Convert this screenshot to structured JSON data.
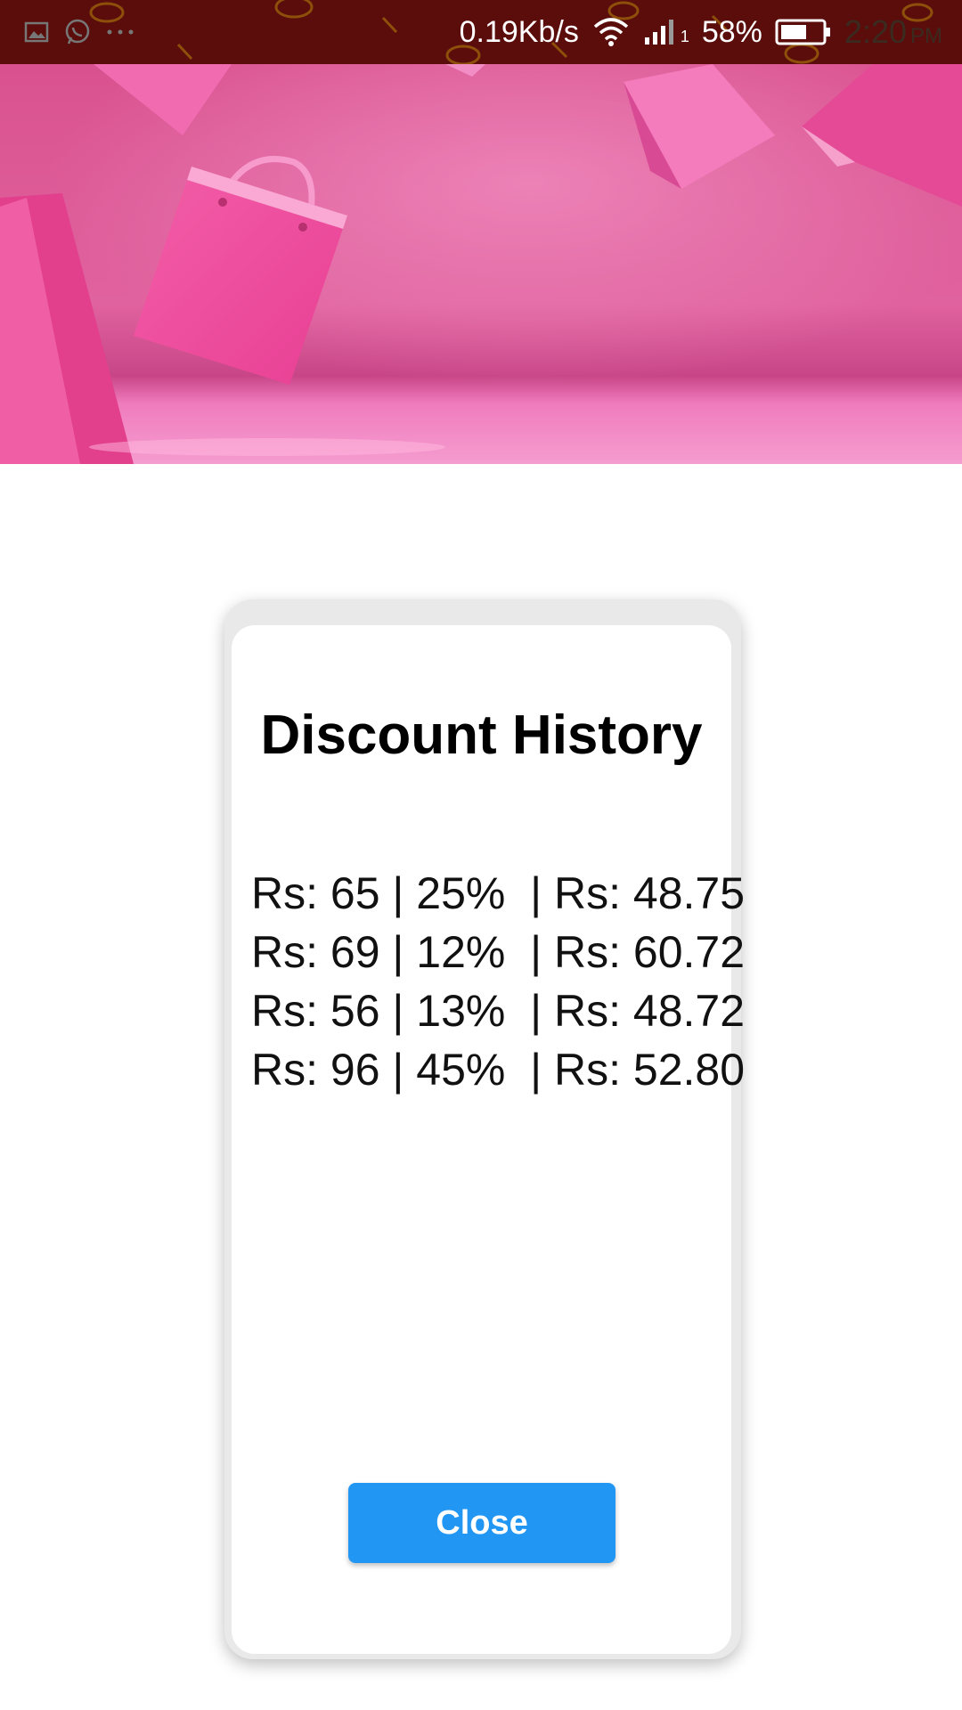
{
  "status_bar": {
    "network_speed": "0.19Kb/s",
    "sim_index": "1",
    "battery_percent": "58%",
    "time": "2:20",
    "ampm": "PM",
    "icons": [
      "gallery-icon",
      "whatsapp-icon",
      "more-icon",
      "wifi-icon",
      "signal-icon",
      "battery-icon"
    ]
  },
  "banner": {
    "description": ""
  },
  "dialog": {
    "title": "Discount History",
    "rows": [
      "Rs: 65 | 25%  | Rs: 48.75",
      "Rs: 69 | 12%  | Rs: 60.72",
      "Rs: 56 | 13%  | Rs: 48.72",
      "Rs: 96 | 45%  | Rs: 52.80"
    ],
    "close_label": "Close"
  },
  "colors": {
    "status_bar_bg": "#5a0d0a",
    "banner_pink": "#e35aa0",
    "close_button": "#2196f3"
  }
}
